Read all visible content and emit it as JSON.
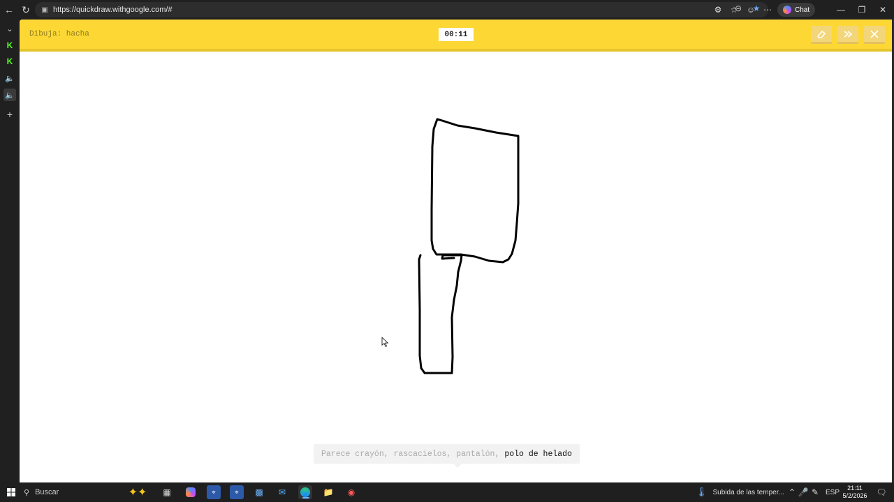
{
  "browser": {
    "url": "https://quickdraw.withgoogle.com/#",
    "chat_label": "Chat"
  },
  "app": {
    "prompt": "Dibuja: hacha",
    "timer": "00:11",
    "guess_prefix": "Parece crayón, rascacielos, pantalón,",
    "guess_current": "polo de helado"
  },
  "taskbar": {
    "search_label": "Buscar",
    "weather_text": "Subida de las temper...",
    "language": "ESP",
    "time": "21:11",
    "date": "5/2/2026"
  },
  "colors": {
    "header_yellow": "#fdd835",
    "stroke": "#000000"
  }
}
